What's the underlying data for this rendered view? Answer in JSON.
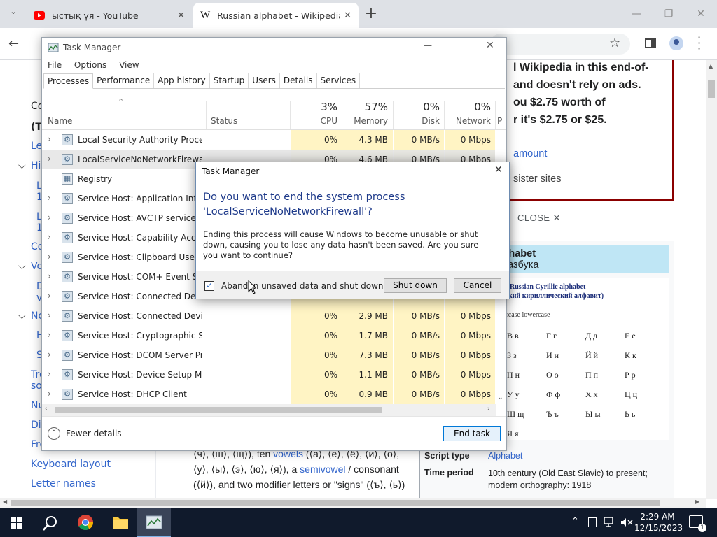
{
  "chrome": {
    "tabs": [
      {
        "title": "ыстық үя - YouTube",
        "icon": "youtube-icon"
      },
      {
        "title": "Russian alphabet - Wikipedia",
        "icon": "wikipedia-icon"
      }
    ],
    "new_tab": "+",
    "minimize": "—",
    "restore": "❐",
    "close": "✕"
  },
  "wiki": {
    "sidebar": [
      "Co",
      "(T",
      "Le",
      "His",
      "L",
      "1",
      "L",
      "1",
      "Co",
      "Vo",
      "D",
      "v",
      "No",
      "H",
      "S",
      "Tre",
      "so",
      "Nu",
      "Dia",
      "Fre",
      "Keyboard layout",
      "Letter names"
    ],
    "donate_lines": [
      "l Wikipedia in this end-of-",
      "and doesn't rely on ads.",
      "ou $2.75 worth of",
      "r it's $2.75 or $25."
    ],
    "donate_link1": "amount",
    "donate_link2": "sister sites",
    "close_label": "CLOSE ✕",
    "infobox": {
      "title": "sian Cyrillic alphabet",
      "subtitle": "кириллическая азбука",
      "img_title": "Russian Cyrillic alphabet",
      "img_subtitle": "кий кириллический алфавит)",
      "img_caption": "ercase lowercase",
      "letters": [
        "В в",
        "Г г",
        "Д д",
        "Е е",
        "З з",
        "И и",
        "Й й",
        "К к",
        "Н н",
        "О о",
        "П п",
        "Р р",
        "У у",
        "Ф ф",
        "Х х",
        "Ц ц",
        "Ш щ",
        "Ъ ъ",
        "Ы ы",
        "Ь ь",
        "Я я"
      ],
      "script_type_label": "Script type",
      "script_type_value": "Alphabet",
      "time_period_label": "Time period",
      "time_period_value1": "10th century (Old East Slavic) to present;",
      "time_period_value2": "modern orthography: 1918"
    },
    "body_line1": "⟨ч⟩, ⟨ш⟩, ⟨щ⟩), ten",
    "body_link1": "vowels",
    "body_line1b": "⟨а⟩, ⟨е⟩, ⟨ё⟩, ⟨и⟩, ⟨о⟩,",
    "body_line2": "⟨у⟩, ⟨ы⟩, ⟨э⟩, ⟨ю⟩, ⟨я⟩), a",
    "body_link2": "semivowel",
    "body_line2b": "/ consonant",
    "body_line3": "⟨й⟩), and two modifier letters or \"signs\" (⟨ъ⟩, ⟨ь⟩)"
  },
  "taskmanager": {
    "title": "Task Manager",
    "menu": [
      "File",
      "Options",
      "View"
    ],
    "tabs": [
      "Processes",
      "Performance",
      "App history",
      "Startup",
      "Users",
      "Details",
      "Services"
    ],
    "columns": {
      "name": "Name",
      "status": "Status",
      "cpu_pct": "3%",
      "cpu": "CPU",
      "mem_pct": "57%",
      "mem": "Memory",
      "disk_pct": "0%",
      "disk": "Disk",
      "net_pct": "0%",
      "net": "Network",
      "p": "P"
    },
    "rows": [
      {
        "name": "Local Security Authority Process...",
        "cpu": "0%",
        "mem": "4.3 MB",
        "disk": "0 MB/s",
        "net": "0 Mbps",
        "expand": true
      },
      {
        "name": "LocalServiceNoNetworkFirewall...",
        "cpu": "0%",
        "mem": "4.6 MB",
        "disk": "0 MB/s",
        "net": "0 Mbps",
        "expand": true
      },
      {
        "name": "Registry",
        "cpu": "",
        "mem": "",
        "disk": "",
        "net": "",
        "expand": false
      },
      {
        "name": "Service Host: Application Infor...",
        "cpu": "",
        "mem": "",
        "disk": "",
        "net": "",
        "expand": true
      },
      {
        "name": "Service Host: AVCTP service",
        "cpu": "",
        "mem": "",
        "disk": "",
        "net": "",
        "expand": true
      },
      {
        "name": "Service Host: Capability Access ...",
        "cpu": "",
        "mem": "",
        "disk": "",
        "net": "",
        "expand": true
      },
      {
        "name": "Service Host: Clipboard User Ser...",
        "cpu": "",
        "mem": "",
        "disk": "",
        "net": "",
        "expand": true
      },
      {
        "name": "Service Host: COM+ Event Syste...",
        "cpu": "",
        "mem": "",
        "disk": "",
        "net": "",
        "expand": true
      },
      {
        "name": "Service Host: Connected Device...",
        "cpu": "",
        "mem": "",
        "disk": "",
        "net": "",
        "expand": true
      },
      {
        "name": "Service Host: Connected Device...",
        "cpu": "0%",
        "mem": "2.9 MB",
        "disk": "0 MB/s",
        "net": "0 Mbps",
        "expand": true
      },
      {
        "name": "Service Host: Cryptographic Ser...",
        "cpu": "0%",
        "mem": "1.7 MB",
        "disk": "0 MB/s",
        "net": "0 Mbps",
        "expand": true
      },
      {
        "name": "Service Host: DCOM Server Proc...",
        "cpu": "0%",
        "mem": "7.3 MB",
        "disk": "0 MB/s",
        "net": "0 Mbps",
        "expand": true
      },
      {
        "name": "Service Host: Device Setup Man...",
        "cpu": "0%",
        "mem": "1.1 MB",
        "disk": "0 MB/s",
        "net": "0 Mbps",
        "expand": true
      },
      {
        "name": "Service Host: DHCP Client",
        "cpu": "0%",
        "mem": "0.9 MB",
        "disk": "0 MB/s",
        "net": "0 Mbps",
        "expand": true
      }
    ],
    "fewer_details": "Fewer details",
    "end_task": "End task"
  },
  "dialog": {
    "title": "Task Manager",
    "heading": "Do you want to end the system process 'LocalServiceNoNetworkFirewall'?",
    "body": "Ending this process will cause Windows to become unusable or shut down, causing you to lose any data hasn't been saved. Are you sure you want to continue?",
    "checkbox_label": "Abandon unsaved data and shut down.",
    "checkbox_checked": true,
    "shutdown": "Shut down",
    "cancel": "Cancel"
  },
  "taskbar": {
    "time": "2:29 AM",
    "date": "12/15/2023",
    "notifications": "1"
  }
}
